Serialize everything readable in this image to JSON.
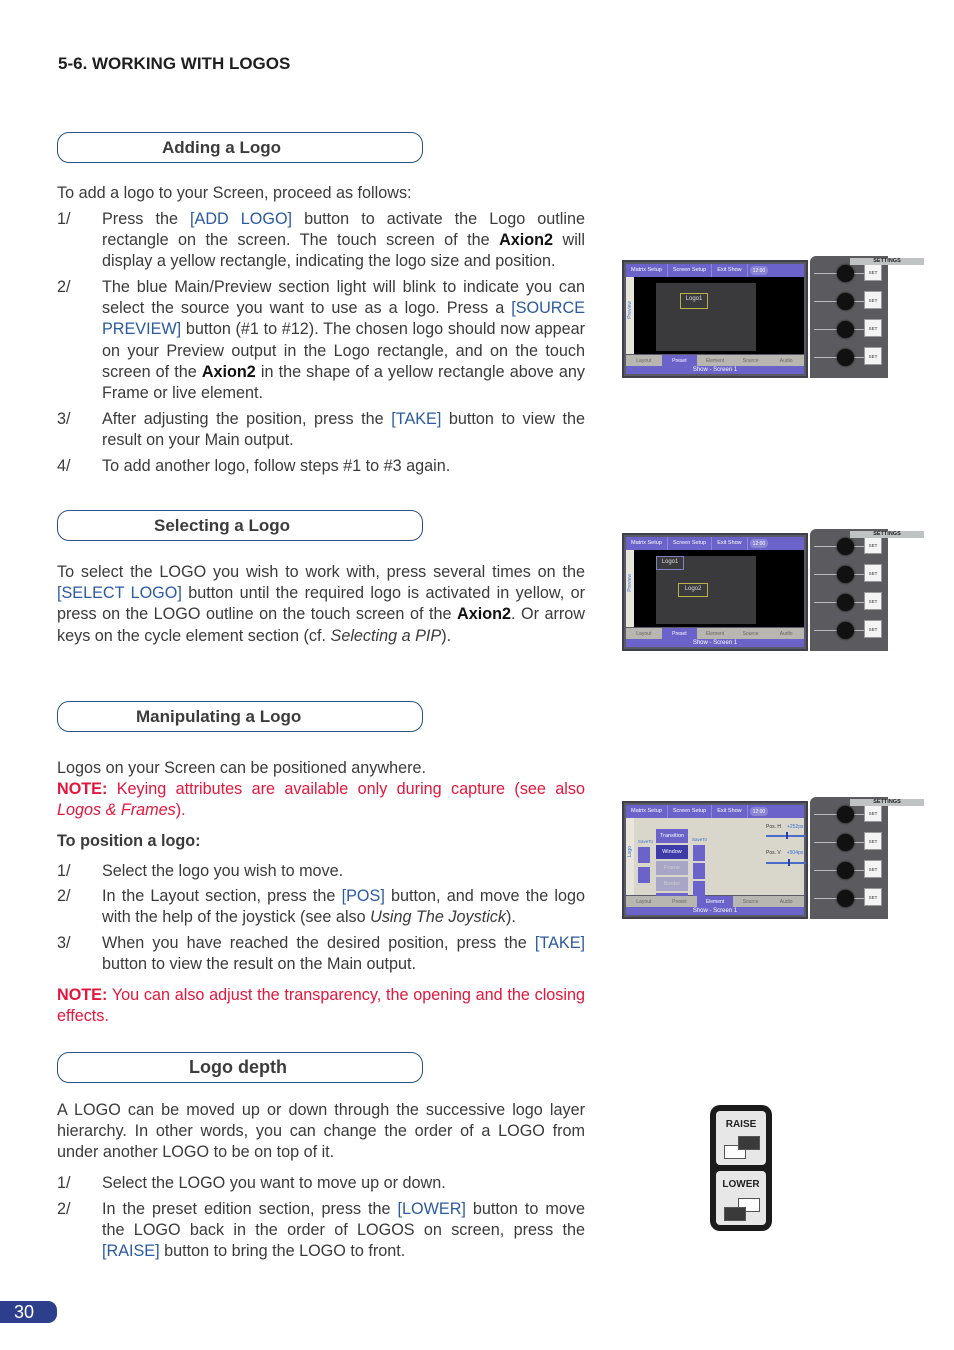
{
  "page_heading": "5-6. WORKING WITH LOGOS",
  "page_number": "30",
  "sections": {
    "adding": {
      "title": "Adding a Logo",
      "intro": "To add a logo to your Screen, proceed as follows:",
      "steps": [
        {
          "num": "1/",
          "parts": [
            {
              "t": "Press the "
            },
            {
              "t": "[ADD LOGO]",
              "k": "kw"
            },
            {
              "t": " button to activate the Logo outline rectangle on the screen. The touch screen of the "
            },
            {
              "t": "Axion2",
              "k": "bold"
            },
            {
              "t": " will display a yellow rectangle, indicating the logo size and position."
            }
          ]
        },
        {
          "num": "2/",
          "parts": [
            {
              "t": "The blue Main/Preview section light will blink to indicate you can select the source you want to use as a logo. Press a "
            },
            {
              "t": "[SOURCE PREVIEW]",
              "k": "kw"
            },
            {
              "t": " button (#1 to #12). The chosen logo should now appear on your Preview output in the Logo rectangle, and on the touch screen of the "
            },
            {
              "t": "Axion2",
              "k": "bold"
            },
            {
              "t": " in the shape of a yellow rectangle above any Frame or live element."
            }
          ]
        },
        {
          "num": "3/",
          "parts": [
            {
              "t": "After adjusting the position, press the "
            },
            {
              "t": "[TAKE]",
              "k": "kw"
            },
            {
              "t": " button to view the result on your Main output."
            }
          ]
        },
        {
          "num": "4/",
          "parts": [
            {
              "t": "To add another logo, follow steps #1 to #3 again."
            }
          ]
        }
      ]
    },
    "selecting": {
      "title": "Selecting a Logo",
      "body": [
        {
          "t": "To select the LOGO you wish to work with, press several times on the "
        },
        {
          "t": "[SELECT LOGO]",
          "k": "kw"
        },
        {
          "t": " button until the required logo is activated in yellow, or press on the LOGO outline on the touch screen of the "
        },
        {
          "t": "Axion2",
          "k": "bold"
        },
        {
          "t": ". Or arrow keys on the cycle element section (cf. "
        },
        {
          "t": "Selecting a PIP",
          "k": "it"
        },
        {
          "t": ")."
        }
      ]
    },
    "manipulating": {
      "title": "Manipulating a Logo",
      "intro": "Logos on your Screen can be positioned anywhere.",
      "note1_label": "NOTE:",
      "note1_text": " Keying attributes are available only during capture (see also ",
      "note1_link": "Logos & Frames",
      "note1_end": ").",
      "subheading": "To position a logo:",
      "steps": [
        {
          "num": "1/",
          "parts": [
            {
              "t": "Select the logo you wish to move."
            }
          ]
        },
        {
          "num": "2/",
          "parts": [
            {
              "t": "In the Layout section, press the "
            },
            {
              "t": "[POS]",
              "k": "kw"
            },
            {
              "t": " button, and move the logo with the help of the joystick (see also "
            },
            {
              "t": "Using The Joystick",
              "k": "it"
            },
            {
              "t": ")."
            }
          ]
        },
        {
          "num": "3/",
          "parts": [
            {
              "t": "When you have reached the desired position, press the "
            },
            {
              "t": "[TAKE]",
              "k": "kw"
            },
            {
              "t": " button to view the result on the Main output."
            }
          ]
        }
      ],
      "note2_label": "NOTE:",
      "note2_text": " You can also adjust the transparency, the opening and the closing effects."
    },
    "depth": {
      "title": "Logo depth",
      "body": "A LOGO can be moved up or down through the successive logo layer hierarchy. In other words, you can change the order of a LOGO from under another LOGO to be on top of it.",
      "steps": [
        {
          "num": "1/",
          "parts": [
            {
              "t": "Select the LOGO you want to move up or down."
            }
          ]
        },
        {
          "num": "2/",
          "parts": [
            {
              "t": "In the preset edition section, press the "
            },
            {
              "t": "[LOWER]",
              "k": "kw"
            },
            {
              "t": " button to move the LOGO back in the order of LOGOS on screen, press the "
            },
            {
              "t": "[RAISE]",
              "k": "kw"
            },
            {
              "t": " button to bring the LOGO to front."
            }
          ]
        }
      ]
    }
  },
  "touchscreen": {
    "top_buttons": [
      "Matrix Setup",
      "Screen Setup",
      "Exit Show"
    ],
    "status_button": "12:00",
    "side_label_preview": "Preview",
    "side_label_logo": "Logo",
    "tabs": [
      "Layout",
      "Preset",
      "Element",
      "Source",
      "Audio"
    ],
    "footer": "Show - Screen 1",
    "settings_label": "SETTINGS",
    "set_label": "SET",
    "shot1": {
      "logos": [
        "Logo1"
      ],
      "active_tab": "Preset"
    },
    "shot2": {
      "logos": [
        "Logo1",
        "Logo2"
      ],
      "active_tab": "Preset"
    },
    "shot3": {
      "active_tab": "Element",
      "element_buttons": [
        "Transition",
        "Window",
        "Frame",
        "Border",
        "Transp."
      ],
      "save_to_label": "SaveTo",
      "pos_h_label": "Pos. H",
      "pos_h_value": "+252px",
      "pos_v_label": "Pos. V",
      "pos_v_value": "+504px"
    }
  },
  "raise_lower": {
    "raise_label": "RAISE",
    "lower_label": "LOWER"
  },
  "colors": {
    "keyword_blue": "#2a5aa0",
    "note_red": "#e3163c",
    "pill_border": "#2b4f8a",
    "touch_purple": "#6b63c9"
  }
}
